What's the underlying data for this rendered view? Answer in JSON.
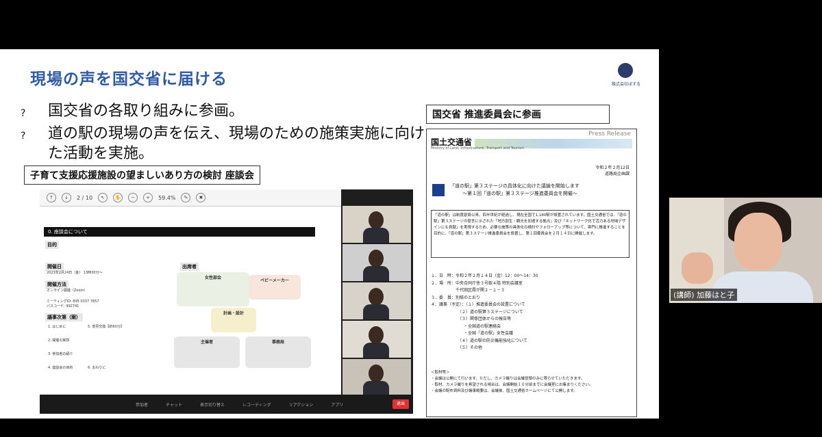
{
  "slide": {
    "title": "現場の声を国交省に届ける",
    "logo_caption": "株式会社ぼする",
    "bullets": [
      {
        "marker": "?",
        "text": "国交省の各取り組みに参画。"
      },
      {
        "marker": "?",
        "text": "道の駅の現場の声を伝え、現場のための施策実施に向けた活動を実施。"
      }
    ],
    "left_label": "子育て支援応援施設の望ましいあり方の検討 座談会",
    "right_label": "国交省 推進委員会に参画"
  },
  "zoom": {
    "page_indicator": "2 / 10",
    "zoom_level": "59.4%",
    "doc_header": "0. 座談会について",
    "sections": [
      "目的",
      "開催日",
      "開催方法",
      "議事次第（案）"
    ],
    "date_text": "2023年2月24日（金） 13時30分～",
    "method_text": "オンライン開催（Zoom）",
    "meeting_id": "ミーティングID: 895 0337 7857",
    "passcode": "パスコード: 992741",
    "agenda": [
      "1. はじめに",
      "2. 開催の挨拶",
      "3. 参加者の紹介",
      "4. 座談会の目的",
      "5. 意見交換【約60分】",
      "6. おわりに"
    ],
    "orgs": {
      "top": "出席者",
      "women": "女性部会",
      "babymaker": "ベビーメーカー",
      "facilitator": "計画・設計",
      "chair": "主催者",
      "secretariat": "事務局"
    },
    "toolbar": [
      "参加者",
      "チャット",
      "表示切り替え",
      "レコーディング",
      "リアクション",
      "アプリ"
    ],
    "leave_label": "退出"
  },
  "press": {
    "release_label": "Press Release",
    "ministry": "国土交通省",
    "ministry_en": "Ministry of Land, Infrastructure, Transport and Tourism",
    "date_lines": [
      "令和２年２月12日",
      "道路局企画課"
    ],
    "headline_1": "「道の駅」第３ステージの具体化に向けた議論を開始します",
    "headline_2": "～第１回「道の駅」第３ステージ推進委員会を開催～",
    "lead": "「道の駅」は制度創設以来、四半世紀が経過し、現在全国で1,180駅が設置されています。国土交通省では、「道の駅」第３ステージの提言に示された「地方創生・観光を加速する拠点」及び「ネットワーク化で活力ある地域デザインにも貢献」を実現するため、必要な施策の具体化の検討やフォローアップ等について、専門に推進することを目的に、「道の駅」第３ステージ推進委員会を設置し、第１回委員会を２月１４日に開催します。",
    "items": [
      "１．日　時：令和２年２月１４日（金）12：00～14：30",
      "２．場　所：中央合同庁舎３号館４階 特別会議室",
      "　　　　　　千代田区霞が関２－１－３",
      "３．委　員：別紙のとおり",
      "４．議事（予定）：（１）推進委員会の設置について",
      "　　　　　　　（２）道の駅第３ステージについて",
      "　　　　　　　（３）関係団体からの報告等",
      "　　　　　　　　・全国道の駅連絡会",
      "　　　　　　　　・全国「道の駅」女性会議",
      "　　　　　　　（４）道の駅の防災機能強化について",
      "　　　　　　　（５）その他"
    ],
    "notes": [
      "＜取材等＞",
      "・会議は公開にて行います。ただし、カメラ撮りは会議冒頭のみに限らせていただきます。",
      "・取材、カメラ撮りを希望される場合は、会議開始１０分前までに会議室にお集まりください。",
      "・会議の配布資料及び議事概要は、会議後、国土交通省ホームページにて公開します。"
    ]
  },
  "webcam": {
    "name_label": "(講師) 加藤はと子"
  }
}
